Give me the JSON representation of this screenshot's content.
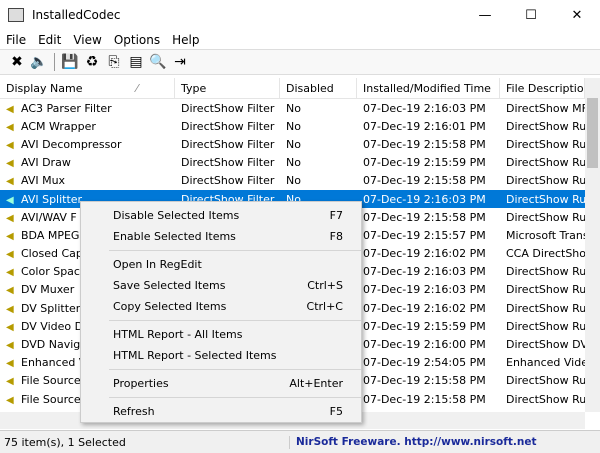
{
  "window": {
    "title": "InstalledCodec",
    "minimize": "—",
    "maximize": "☐",
    "close": "✕"
  },
  "menu": [
    "File",
    "Edit",
    "View",
    "Options",
    "Help"
  ],
  "toolbar": [
    {
      "icon": "disable-icon",
      "g": "✖"
    },
    {
      "icon": "enable-speaker-icon",
      "g": "🔈"
    },
    {
      "icon": "save-icon",
      "g": "💾"
    },
    {
      "icon": "refresh-icon",
      "g": "♻"
    },
    {
      "icon": "copy-icon",
      "g": "⎘"
    },
    {
      "icon": "properties-icon",
      "g": "▤"
    },
    {
      "icon": "find-icon",
      "g": "🔍"
    },
    {
      "icon": "exit-icon",
      "g": "⇥"
    }
  ],
  "columns": [
    "Display Name",
    "Type",
    "Disabled",
    "Installed/Modified Time",
    "File Description"
  ],
  "sort_indicator": "⁄",
  "rows": [
    [
      "AC3 Parser Filter",
      "DirectShow Filter",
      "No",
      "07-Dec-19 2:16:03 PM",
      "DirectShow MF"
    ],
    [
      "ACM Wrapper",
      "DirectShow Filter",
      "No",
      "07-Dec-19 2:16:01 PM",
      "DirectShow Ru"
    ],
    [
      "AVI Decompressor",
      "DirectShow Filter",
      "No",
      "07-Dec-19 2:15:58 PM",
      "DirectShow Ru"
    ],
    [
      "AVI Draw",
      "DirectShow Filter",
      "No",
      "07-Dec-19 2:15:59 PM",
      "DirectShow Ru"
    ],
    [
      "AVI Mux",
      "DirectShow Filter",
      "No",
      "07-Dec-19 2:15:58 PM",
      "DirectShow Ru"
    ],
    [
      "AVI Splitter",
      "DirectShow Filter",
      "No",
      "07-Dec-19 2:16:03 PM",
      "DirectShow Ru"
    ],
    [
      "AVI/WAV F",
      "",
      "",
      "07-Dec-19 2:15:58 PM",
      "DirectShow Ru"
    ],
    [
      "BDA MPEG",
      "",
      "",
      "07-Dec-19 2:15:57 PM",
      "Microsoft Trans"
    ],
    [
      "Closed Cap",
      "",
      "",
      "07-Dec-19 2:16:02 PM",
      "CCA DirectSho"
    ],
    [
      "Color Spac",
      "",
      "",
      "07-Dec-19 2:16:03 PM",
      "DirectShow Ru"
    ],
    [
      "DV Muxer",
      "",
      "",
      "07-Dec-19 2:16:03 PM",
      "DirectShow Ru"
    ],
    [
      "DV Splitter",
      "",
      "",
      "07-Dec-19 2:16:02 PM",
      "DirectShow Ru"
    ],
    [
      "DV Video D",
      "",
      "",
      "07-Dec-19 2:15:59 PM",
      "DirectShow Ru"
    ],
    [
      "DVD Navig",
      "",
      "",
      "07-Dec-19 2:16:00 PM",
      "DirectShow DV"
    ],
    [
      "Enhanced V",
      "",
      "",
      "07-Dec-19 2:54:05 PM",
      "Enhanced Vide"
    ],
    [
      "File Source",
      "",
      "",
      "07-Dec-19 2:15:58 PM",
      "DirectShow Ru"
    ],
    [
      "File Source",
      "",
      "",
      "07-Dec-19 2:15:58 PM",
      "DirectShow Ru"
    ]
  ],
  "selected_row": 5,
  "context_menu": [
    [
      {
        "label": "Disable Selected Items",
        "key": "F7"
      },
      {
        "label": "Enable Selected Items",
        "key": "F8"
      }
    ],
    [
      {
        "label": "Open In RegEdit",
        "key": ""
      },
      {
        "label": "Save Selected Items",
        "key": "Ctrl+S"
      },
      {
        "label": "Copy Selected Items",
        "key": "Ctrl+C"
      }
    ],
    [
      {
        "label": "HTML Report - All Items",
        "key": ""
      },
      {
        "label": "HTML Report - Selected Items",
        "key": ""
      }
    ],
    [
      {
        "label": "Properties",
        "key": "Alt+Enter"
      }
    ],
    [
      {
        "label": "Refresh",
        "key": "F5"
      }
    ]
  ],
  "status": {
    "count": "75 item(s), 1 Selected",
    "link": "NirSoft Freeware.  http://www.nirsoft.net"
  },
  "colors": {
    "selection": "#0078d7",
    "link": "#1a2a9a"
  }
}
